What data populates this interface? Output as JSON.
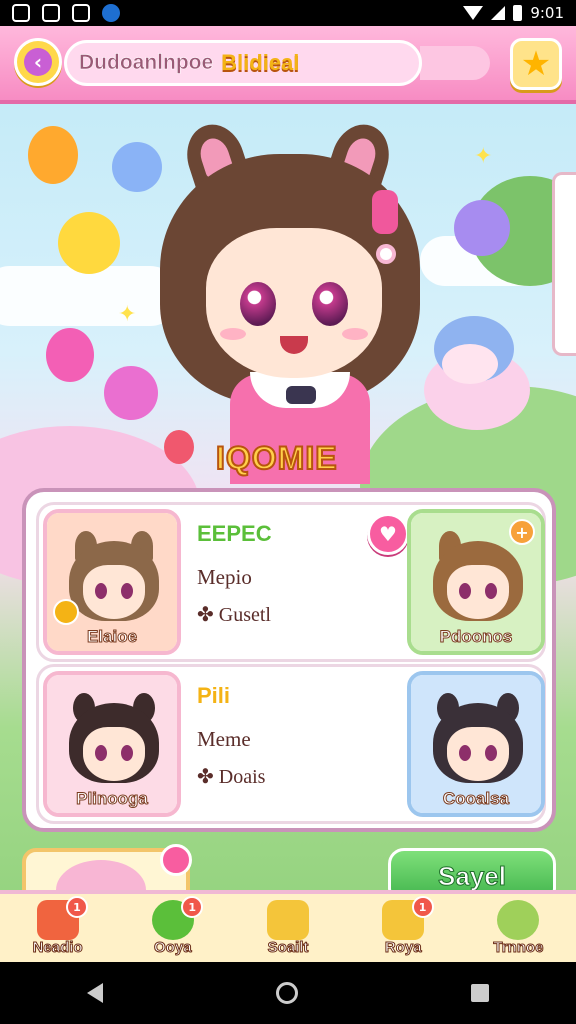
{
  "status_bar": {
    "time": "9:01"
  },
  "header": {
    "title_a": "Dudoanlnpoe",
    "title_b": "Blidieal"
  },
  "hero": {
    "name": "IQOMIE"
  },
  "cards": [
    {
      "portrait_label": "Elaioe",
      "tag": "EEPEC",
      "line1": "Mepio",
      "line2": "✤ Gusetl",
      "right_label": "Pdoonos",
      "tag_color": "#5bbf3a"
    },
    {
      "portrait_label": "Plinooga",
      "tag": "Pili",
      "line1": "Meme",
      "line2": "✤ Doais",
      "right_label": "Cooalsa",
      "tag_color": "#f4b315"
    }
  ],
  "save_button": "Sayel",
  "nav": [
    {
      "label": "Neadio",
      "badge": "1",
      "color": "#f0643f"
    },
    {
      "label": "Ooya",
      "badge": "1",
      "color": "#5bbf3a"
    },
    {
      "label": "Soailt",
      "badge": "",
      "color": "#f4c53a"
    },
    {
      "label": "Roya",
      "badge": "1",
      "color": "#f4c53a"
    },
    {
      "label": "Trnnoe",
      "badge": "",
      "color": "#9fd05a"
    }
  ]
}
